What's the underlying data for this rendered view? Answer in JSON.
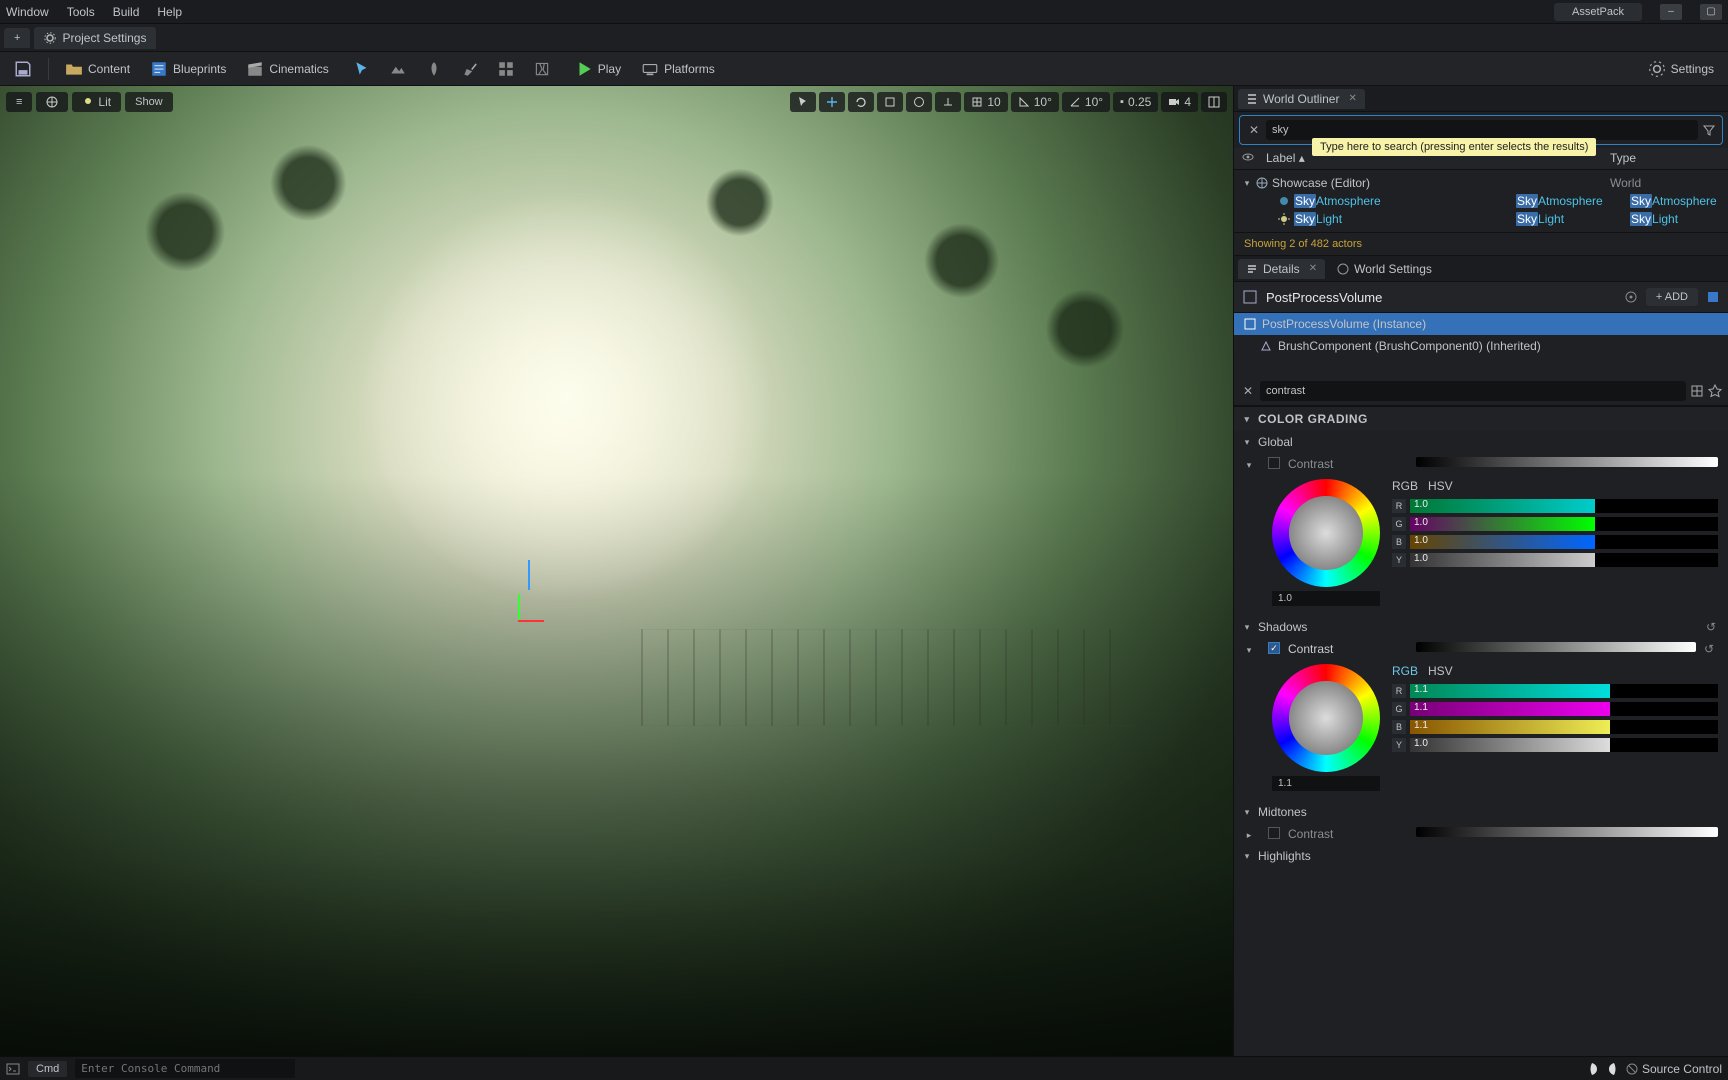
{
  "menu": {
    "window": "Window",
    "tools": "Tools",
    "build": "Build",
    "help": "Help",
    "asset": "AssetPack"
  },
  "subtabs": {
    "proj": "Project Settings"
  },
  "toolbar": {
    "content": "Content",
    "blueprints": "Blueprints",
    "cinematics": "Cinematics",
    "play": "Play",
    "platforms": "Platforms",
    "settings": "Settings"
  },
  "viewport": {
    "lit": "Lit",
    "show": "Show",
    "snap_deg": "10°",
    "snap_deg2": "10°",
    "snap_scale": "0.25",
    "cam": "4",
    "grid": "10"
  },
  "outliner": {
    "tab": "World Outliner",
    "search": "sky",
    "tooltip": "Type here to search (pressing enter selects the results)",
    "cols": {
      "label": "Label",
      "type": "Type"
    },
    "root": "Showcase (Editor)",
    "root_type": "World",
    "items": [
      {
        "pre": "Sky",
        "rest": "Atmosphere",
        "t_pre": "Sky",
        "t_rest": "Atmosphere",
        "t2_pre": "Sky",
        "t2_rest": "Atmosphere"
      },
      {
        "pre": "Sky",
        "rest": "Light",
        "t_pre": "Sky",
        "t_rest": "Light",
        "t2_pre": "Sky",
        "t2_rest": "Light"
      }
    ],
    "status": "Showing 2 of 482 actors"
  },
  "details": {
    "tab": "Details",
    "tab2": "World Settings",
    "actor": "PostProcessVolume",
    "add": "+ ADD",
    "comp_sel": "PostProcessVolume (Instance)",
    "comp_child": "BrushComponent (BrushComponent0) (Inherited)",
    "search": "contrast",
    "cat": "COLOR GRADING",
    "global": "Global",
    "shadows": "Shadows",
    "midtones": "Midtones",
    "highlights": "Highlights",
    "contrast": "Contrast",
    "rgb": "RGB",
    "hsv": "HSV",
    "g_val": "1.0",
    "g_r": "1.0",
    "g_g": "1.0",
    "g_b": "1.0",
    "g_y": "1.0",
    "s_val": "1.1",
    "s_r": "1.1",
    "s_g": "1.1",
    "s_b": "1.1",
    "s_y": "1.0"
  },
  "cmd": {
    "label": "Cmd",
    "placeholder": "Enter Console Command",
    "source": "Source Control"
  }
}
